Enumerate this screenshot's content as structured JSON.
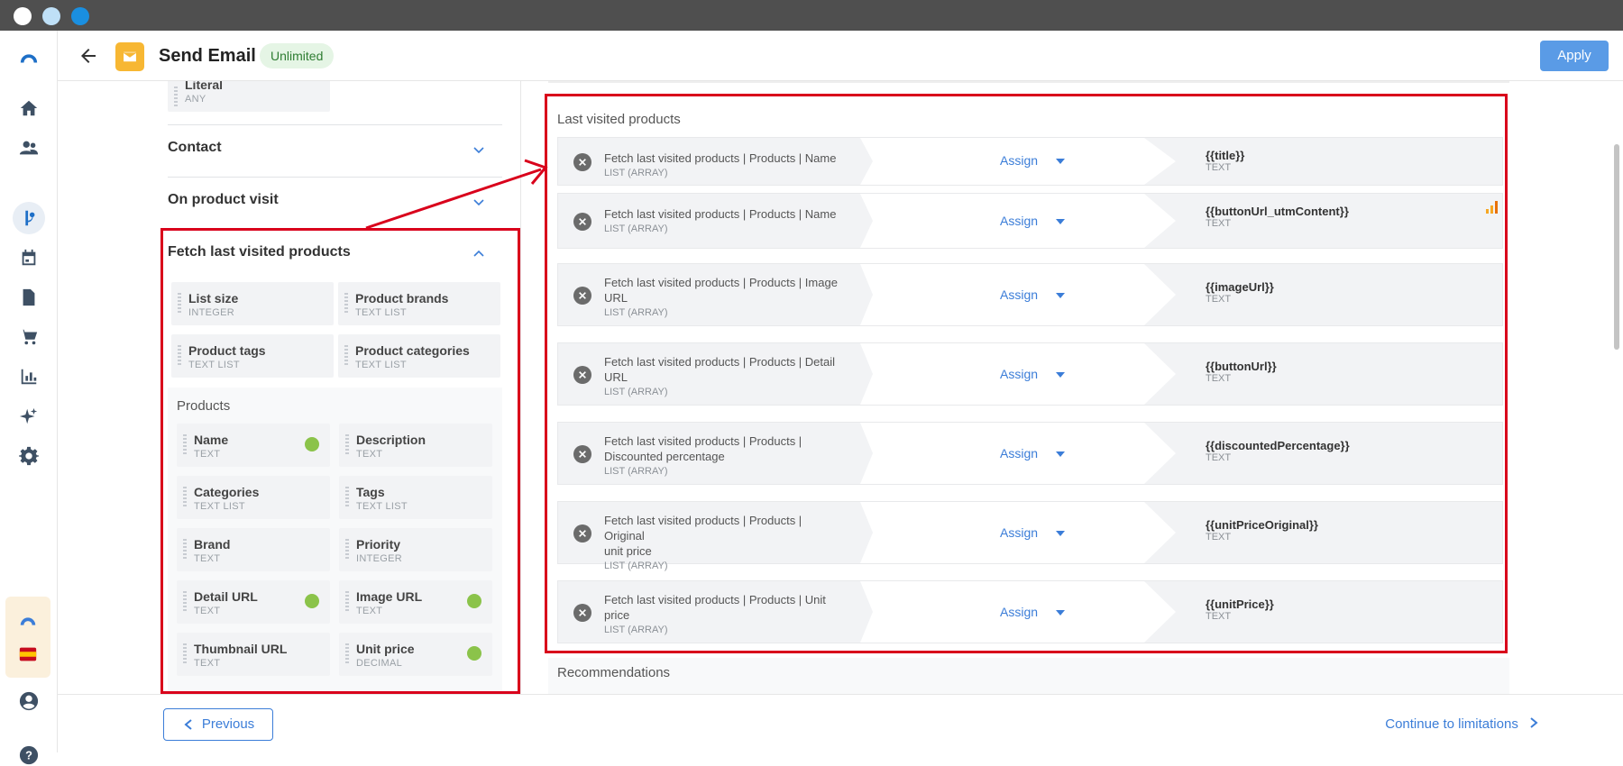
{
  "header": {
    "title": "Send Email",
    "badge": "Unlimited",
    "apply_label": "Apply"
  },
  "nav": {
    "icons": [
      "logo-icon",
      "home-icon",
      "people-icon",
      "flow-icon",
      "calendar-icon",
      "document-icon",
      "cart-icon",
      "chart-icon",
      "sparkle-icon",
      "gear-icon",
      "brand-icon",
      "spain-flag-icon",
      "account-icon",
      "help-icon"
    ]
  },
  "left": {
    "literal": {
      "name": "Literal",
      "type": "ANY"
    },
    "sections": [
      "Contact",
      "On product visit",
      "Fetch last visited products"
    ],
    "fetch_fields": [
      {
        "name": "List size",
        "type": "INTEGER"
      },
      {
        "name": "Product brands",
        "type": "TEXT LIST"
      },
      {
        "name": "Product tags",
        "type": "TEXT LIST"
      },
      {
        "name": "Product categories",
        "type": "TEXT LIST"
      }
    ],
    "products_label": "Products",
    "product_fields": [
      {
        "name": "Name",
        "type": "TEXT",
        "used": true
      },
      {
        "name": "Description",
        "type": "TEXT",
        "used": false
      },
      {
        "name": "Categories",
        "type": "TEXT LIST",
        "used": false
      },
      {
        "name": "Tags",
        "type": "TEXT LIST",
        "used": false
      },
      {
        "name": "Brand",
        "type": "TEXT",
        "used": false
      },
      {
        "name": "Priority",
        "type": "INTEGER",
        "used": false
      },
      {
        "name": "Detail URL",
        "type": "TEXT",
        "used": true
      },
      {
        "name": "Image URL",
        "type": "TEXT",
        "used": true
      },
      {
        "name": "Thumbnail URL",
        "type": "TEXT",
        "used": false
      },
      {
        "name": "Unit price",
        "type": "DECIMAL",
        "used": true
      }
    ]
  },
  "main": {
    "section_label": "Last visited products",
    "assign_label": "Assign",
    "rows": [
      {
        "src1": "Fetch last visited products | Products | Name",
        "src2": "",
        "src_type": "LIST (ARRAY)",
        "target": "{{title}}",
        "target_type": "TEXT"
      },
      {
        "src1": "Fetch last visited products | Products | Name",
        "src2": "",
        "src_type": "LIST (ARRAY)",
        "target": "{{buttonUrl_utmContent}}",
        "target_type": "TEXT"
      },
      {
        "src1": "Fetch last visited products | Products | Image",
        "src2": "URL",
        "src_type": "LIST (ARRAY)",
        "target": "{{imageUrl}}",
        "target_type": "TEXT"
      },
      {
        "src1": "Fetch last visited products | Products | Detail",
        "src2": "URL",
        "src_type": "LIST (ARRAY)",
        "target": "{{buttonUrl}}",
        "target_type": "TEXT"
      },
      {
        "src1": "Fetch last visited products | Products |",
        "src2": "Discounted percentage",
        "src_type": "LIST (ARRAY)",
        "target": "{{discountedPercentage}}",
        "target_type": "TEXT"
      },
      {
        "src1": "Fetch last visited products | Products | Original",
        "src2": "unit price",
        "src_type": "LIST (ARRAY)",
        "target": "{{unitPriceOriginal}}",
        "target_type": "TEXT"
      },
      {
        "src1": "Fetch last visited products | Products | Unit",
        "src2": "price",
        "src_type": "LIST (ARRAY)",
        "target": "{{unitPrice}}",
        "target_type": "TEXT"
      }
    ],
    "next_section": "Recommendations"
  },
  "footer": {
    "prev_label": "Previous",
    "continue_label": "Continue to limitations"
  },
  "colors": {
    "accent": "#3b7dd8",
    "highlight": "#d9001b",
    "ok": "#8bc34a"
  }
}
